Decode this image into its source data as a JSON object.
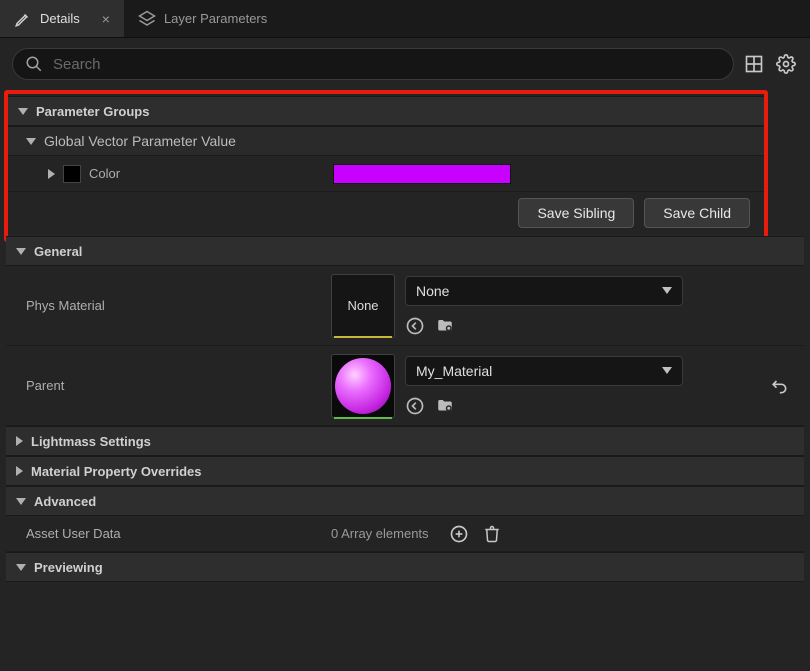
{
  "tabs": {
    "details": "Details",
    "layer_params": "Layer Parameters"
  },
  "search": {
    "placeholder": "Search"
  },
  "sections": {
    "parameter_groups": "Parameter Groups",
    "global_vector": "Global Vector Parameter Value",
    "general": "General",
    "lightmass": "Lightmass Settings",
    "material_overrides": "Material Property Overrides",
    "advanced": "Advanced",
    "previewing": "Previewing"
  },
  "params": {
    "color": {
      "label": "Color",
      "value_hex": "#c800ff"
    }
  },
  "buttons": {
    "save_sibling": "Save Sibling",
    "save_child": "Save Child"
  },
  "general": {
    "phys_material": {
      "label": "Phys Material",
      "value": "None",
      "thumb_text": "None"
    },
    "parent": {
      "label": "Parent",
      "value": "My_Material"
    }
  },
  "advanced": {
    "asset_user_data": {
      "label": "Asset User Data",
      "value": "0 Array elements"
    }
  }
}
